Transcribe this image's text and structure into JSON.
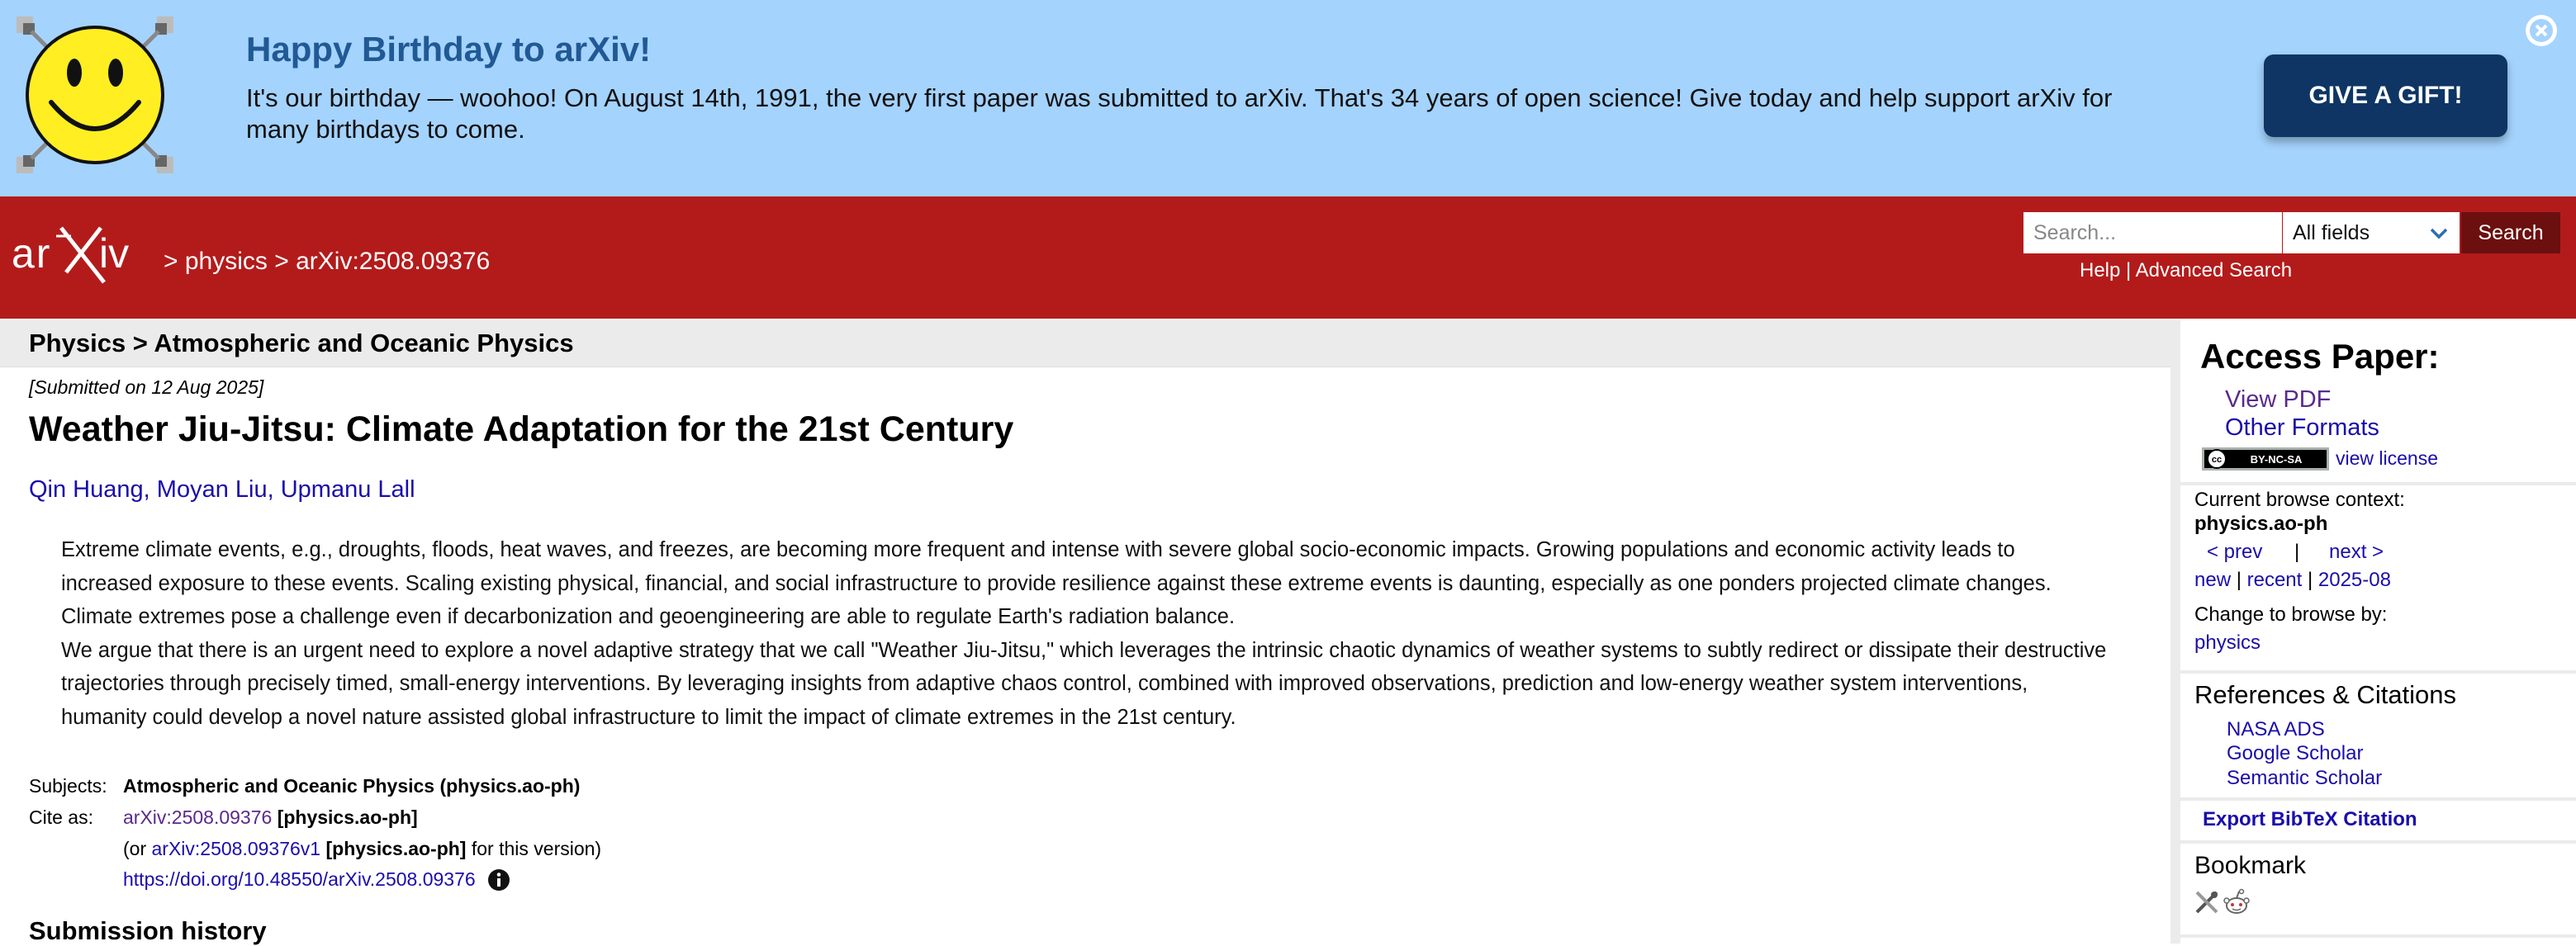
{
  "banner": {
    "title": "Happy Birthday to arXiv!",
    "text": "It's our birthday — woohoo! On August 14th, 1991, the very first paper was submitted to arXiv. That's 34 years of open science! Give today and help support arXiv for many birthdays to come.",
    "gift_button": "GIVE A GIFT!",
    "close_icon": "close-circle-icon",
    "image_icon": "smiley-face-icon"
  },
  "header": {
    "logo_icon": "arxiv-logo",
    "breadcrumb": [
      " > ",
      "physics",
      " > ",
      "arXiv:2508.09376"
    ],
    "search_placeholder": "Search...",
    "field_select": "All fields",
    "search_button": "Search",
    "help_link": "Help",
    "link_sep": " | ",
    "advanced_search_link": "Advanced Search"
  },
  "main": {
    "subject_bar": "Physics > Atmospheric and Oceanic Physics",
    "submitted": "[Submitted on 12 Aug 2025]",
    "title": "Weather Jiu-Jitsu: Climate Adaptation for the 21st Century",
    "authors": [
      "Qin Huang",
      "Moyan Liu",
      "Upmanu Lall"
    ],
    "author_sep": ", ",
    "abstract": [
      "Extreme climate events, e.g., droughts, floods, heat waves, and freezes, are becoming more frequent and intense with severe global socio-economic impacts. Growing populations and economic activity leads to increased exposure to these events. Scaling existing physical, financial, and social infrastructure to provide resilience against these extreme events is daunting, especially as one ponders projected climate changes. Climate extremes pose a challenge even if decarbonization and geoengineering are able to regulate Earth's radiation balance.",
      "We argue that there is an urgent need to explore a novel adaptive strategy that we call \"Weather Jiu-Jitsu,\" which leverages the intrinsic chaotic dynamics of weather systems to subtly redirect or dissipate their destructive trajectories through precisely timed, small-energy interventions. By leveraging insights from adaptive chaos control, combined with improved observations, prediction and low-energy weather system interventions, humanity could develop a novel nature assisted global infrastructure to limit the impact of climate extremes in the 21st century."
    ],
    "meta": {
      "subjects_label": "Subjects:",
      "subjects_value": "Atmospheric and Oceanic Physics (physics.ao-ph)",
      "cite_label": "Cite as:",
      "cite_id": "arXiv:2508.09376",
      "cite_cat": " [physics.ao-ph]",
      "version_prefix": "(or ",
      "version_id": "arXiv:2508.09376v1",
      "version_cat": " [physics.ao-ph]",
      "version_suffix": " for this version)",
      "doi": "https://doi.org/10.48550/arXiv.2508.09376",
      "info_icon": "info-icon"
    },
    "submission_history": "Submission history"
  },
  "sidebar": {
    "access_title": "Access Paper:",
    "view_pdf": "View PDF",
    "other_formats": "Other Formats",
    "license_badge": "BY-NC-SA",
    "view_license": "view license",
    "context_label": "Current browse context:",
    "context_value": "physics.ao-ph",
    "prev": "< prev",
    "pipe": "|",
    "next": "next >",
    "browse_new": "new",
    "browse_sep": " | ",
    "browse_recent": "recent",
    "browse_date": "2025-08",
    "change_label": "Change to browse by:",
    "physics": "physics",
    "refs_title": "References & Citations",
    "nasa": "NASA ADS",
    "google": "Google Scholar",
    "semantic": "Semantic Scholar",
    "bibtex": "Export BibTeX Citation",
    "bookmark_title": "Bookmark",
    "bookmark_icons": [
      "bibsonomy-icon",
      "reddit-icon"
    ]
  },
  "colors": {
    "banner_bg": "#a4d3fd",
    "header_red": "#b31b1b",
    "gift_button": "#0e3564",
    "link_blue": "#1a0dab",
    "link_visited": "#5a2a8c"
  }
}
